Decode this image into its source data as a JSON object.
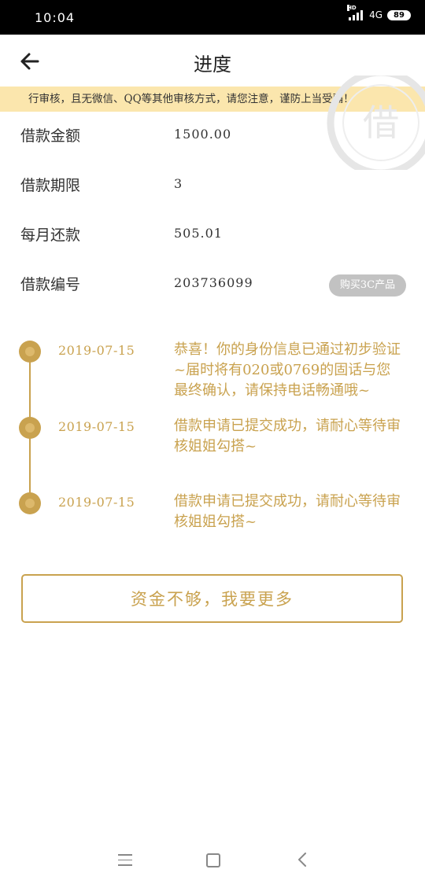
{
  "status_bar": {
    "time": "10:04",
    "network": "4G",
    "hd": "HD",
    "battery": "89"
  },
  "header": {
    "title": "进度",
    "back_icon": "arrow-left-icon"
  },
  "notice": {
    "text": "行审核，且无微信、QQ等其他审核方式，请您注意，谨防上当受骗！"
  },
  "watermark": {
    "text": "借"
  },
  "loan_info": [
    {
      "label": "借款金额",
      "value": "1500.00"
    },
    {
      "label": "借款期限",
      "value": "3"
    },
    {
      "label": "每月还款",
      "value": "505.01"
    },
    {
      "label": "借款编号",
      "value": "203736099"
    }
  ],
  "tag_button": {
    "label": "购买3C产品"
  },
  "timeline": [
    {
      "date": "2019-07-15",
      "text": "恭喜！你的身份信息已通过初步验证~届时将有020或0769的固话与您最终确认，请保持电话畅通哦~"
    },
    {
      "date": "2019-07-15",
      "text": "借款申请已提交成功，请耐心等待审核姐姐勾搭~"
    },
    {
      "date": "2019-07-15",
      "text": "借款申请已提交成功，请耐心等待审核姐姐勾搭~"
    }
  ],
  "more_button": {
    "label": "资金不够，我要更多"
  },
  "colors": {
    "accent": "#c9a24f",
    "notice_bg": "#fbe6ad",
    "tag_bg": "#c2c2c2"
  },
  "nav_bar": {
    "icons": [
      "menu-icon",
      "home-icon",
      "back-icon"
    ]
  }
}
